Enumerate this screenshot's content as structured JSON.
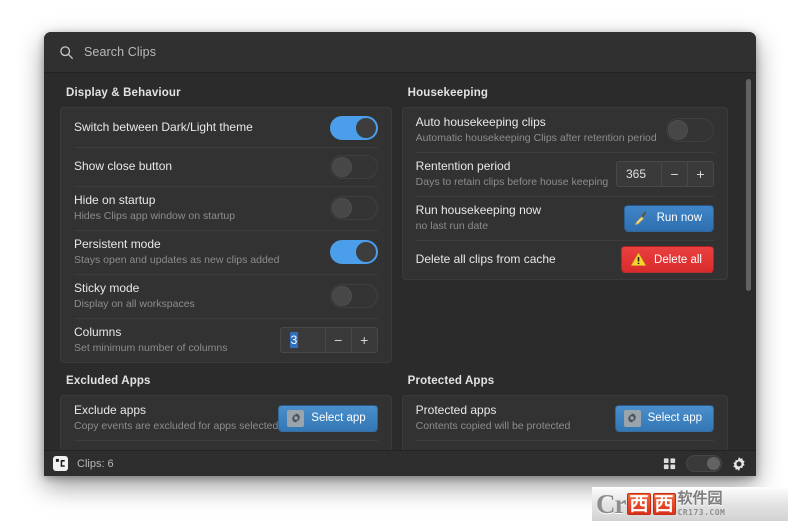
{
  "window": {
    "search": {
      "placeholder": "Search Clips",
      "value": "",
      "icon": "search-icon"
    }
  },
  "sections": {
    "display": {
      "title": "Display & Behaviour",
      "rows": [
        {
          "label": "Switch between Dark/Light theme",
          "sub": "",
          "control": "toggle",
          "state": "on"
        },
        {
          "label": "Show close button",
          "sub": "",
          "control": "toggle",
          "state": "off"
        },
        {
          "label": "Hide on startup",
          "sub": "Hides Clips app window on startup",
          "control": "toggle",
          "state": "off"
        },
        {
          "label": "Persistent mode",
          "sub": "Stays open and updates as new clips added",
          "control": "toggle",
          "state": "on"
        },
        {
          "label": "Sticky mode",
          "sub": "Display on all workspaces",
          "control": "toggle",
          "state": "off"
        },
        {
          "label": "Columns",
          "sub": "Set minimum number of columns",
          "control": "spinner",
          "value": "3",
          "selected": true,
          "minus": "−",
          "plus": "+"
        }
      ]
    },
    "housekeeping": {
      "title": "Housekeeping",
      "rows": [
        {
          "label": "Auto housekeeping clips",
          "sub": "Automatic housekeeping Clips after retention period",
          "control": "toggle",
          "state": "off"
        },
        {
          "label": "Rentention period",
          "sub": "Days to retain clips before house keeping",
          "control": "spinner",
          "value": "365",
          "selected": false,
          "minus": "−",
          "plus": "+"
        },
        {
          "label": "Run housekeeping now",
          "sub": "no last run date",
          "control": "button",
          "button_label": "Run now",
          "button_style": "blue",
          "button_icon": "broom-icon"
        },
        {
          "label": "Delete all clips from cache",
          "sub": "",
          "control": "button",
          "button_label": "Delete all",
          "button_style": "red",
          "button_icon": "warning-icon"
        }
      ]
    },
    "excluded": {
      "title": "Excluded Apps",
      "rows": [
        {
          "label": "Exclude apps",
          "sub": "Copy events are excluded for apps selected",
          "control": "button",
          "button_label": "Select app",
          "button_style": "select",
          "button_icon": "gear-icon"
        }
      ]
    },
    "protected": {
      "title": "Protected Apps",
      "rows": [
        {
          "label": "Protected apps",
          "sub": "Contents copied will be protected",
          "control": "button",
          "button_label": "Select app",
          "button_style": "select",
          "button_icon": "gear-icon"
        }
      ]
    }
  },
  "statusbar": {
    "app_icon": "clips-app-icon",
    "clips_text": "Clips: 6",
    "grid_icon": "grid-view-icon",
    "toggle_state": "off",
    "settings_icon": "gear-icon"
  },
  "watermark": {
    "cr": "Cr",
    "cn1": "西",
    "cn2": "西",
    "soft": "软件园",
    "url": "CR173.COM"
  },
  "colors": {
    "accent_blue": "#4a9eea",
    "button_blue": "#3577b5",
    "danger_red": "#e03535",
    "window_bg": "#2b2b2b",
    "card_bg": "#323232"
  }
}
